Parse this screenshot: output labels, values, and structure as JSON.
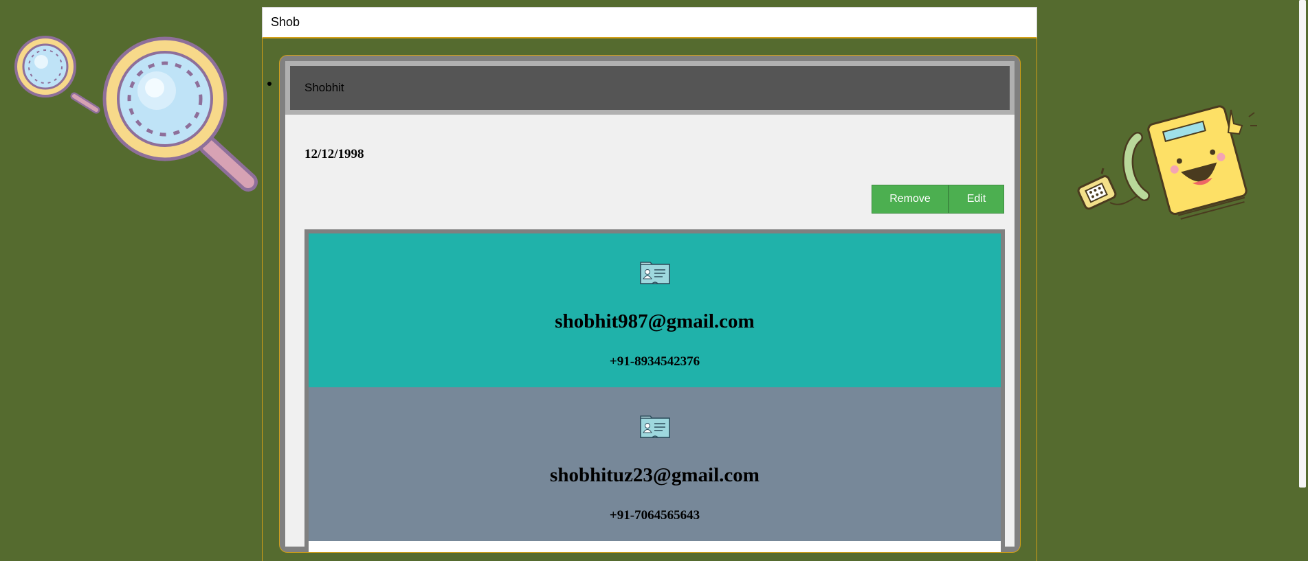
{
  "search": {
    "value": "Shob",
    "placeholder": ""
  },
  "contact": {
    "name": "Shobhit",
    "dob": "12/12/1998",
    "actions": {
      "remove_label": "Remove",
      "edit_label": "Edit"
    },
    "entries": [
      {
        "icon": "contact-card-icon",
        "email": "shobhit987@gmail.com",
        "phone": "+91-8934542376",
        "color": "#20b2aa"
      },
      {
        "icon": "contact-card-icon",
        "email": "shobhituz23@gmail.com",
        "phone": "+91-7064565643",
        "color": "#778899"
      }
    ]
  },
  "decorations": {
    "left": "magnifying-glass-icon",
    "right": "phonebook-mascot-icon"
  },
  "colors": {
    "background": "#556b2f",
    "accent_border": "#d4a017",
    "button": "#4caf50",
    "header": "#555555"
  }
}
